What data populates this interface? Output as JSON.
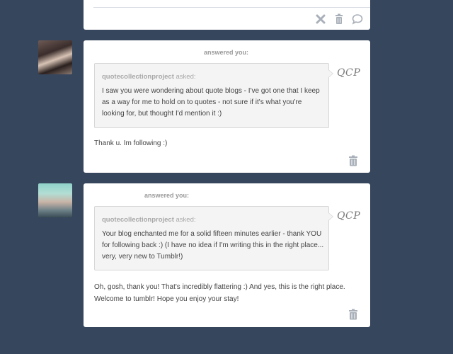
{
  "posts": [
    {
      "answered_label": "answered you:",
      "asker": "quotecollectionproject",
      "asked_suffix": " asked:",
      "question": "I saw you were wondering about quote blogs - I've got one that I keep as a way for me to hold on to quotes - not sure if it's what you're looking for, but thought I'd mention it :)",
      "signature": "QCP",
      "answer": "Thank u. Im following :)"
    },
    {
      "answered_label": "answered you:",
      "asker": "quotecollectionproject",
      "asked_suffix": " asked:",
      "question": "Your blog enchanted me for a solid fifteen minutes earlier - thank YOU for following back :) (I have no idea if I'm writing this in the right place... very, very new to Tumblr!)",
      "signature": "QCP",
      "answer": "Oh, gosh, thank you! That's incredibly flattering :) And yes, this is the right place. Welcome to tumblr! Hope you enjoy your stay!"
    }
  ],
  "icons": {
    "top_actions": [
      "close-icon",
      "trash-icon",
      "reply-icon"
    ],
    "post_action": "trash-icon"
  }
}
